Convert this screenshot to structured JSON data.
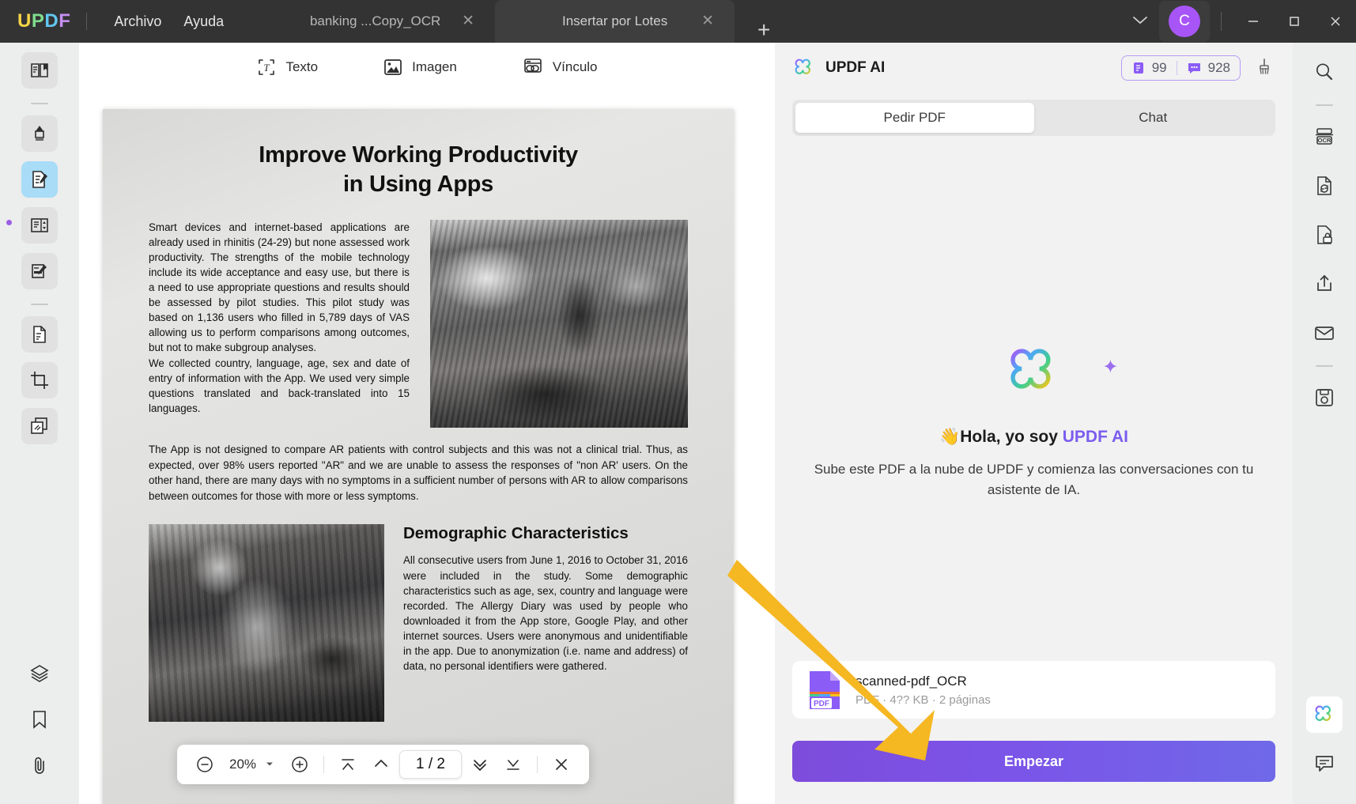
{
  "titlebar": {
    "logo": {
      "u": "U",
      "p": "P",
      "d": "D",
      "f": "F"
    },
    "menus": [
      {
        "name": "archivo",
        "label": "Archivo"
      },
      {
        "name": "ayuda",
        "label": "Ayuda"
      }
    ],
    "tabs": [
      {
        "name": "tab-banking",
        "label": "banking ...Copy_OCR",
        "active": false
      },
      {
        "name": "tab-insertar",
        "label": "Insertar por Lotes",
        "active": true
      }
    ],
    "new_tab_label": "+",
    "chevron_label": "⌄",
    "avatar_initial": "C",
    "window_controls": {
      "minimize": "—",
      "maximize": "☐",
      "close": "✕"
    }
  },
  "doc_toolbar": {
    "items": [
      {
        "name": "texto",
        "label": "Texto",
        "icon": "text-box-icon"
      },
      {
        "name": "imagen",
        "label": "Imagen",
        "icon": "image-icon"
      },
      {
        "name": "vinculo",
        "label": "Vínculo",
        "icon": "link-icon"
      }
    ]
  },
  "left_rail": {
    "items": [
      {
        "name": "reader",
        "icon": "book-reader-icon",
        "selected": false
      },
      {
        "name": "highlighter",
        "icon": "marker-pen-icon",
        "selected": false
      },
      {
        "name": "edit-pdf",
        "icon": "edit-document-icon",
        "selected": true
      },
      {
        "name": "organize-pages",
        "icon": "page-organize-icon",
        "selected": false
      },
      {
        "name": "fill-and-sign",
        "icon": "form-fill-icon",
        "selected": false
      },
      {
        "name": "convert",
        "icon": "document-convert-icon",
        "selected": false
      },
      {
        "name": "crop",
        "icon": "crop-icon",
        "selected": false
      },
      {
        "name": "compare",
        "icon": "layers-copy-icon",
        "selected": false
      },
      {
        "name": "layers",
        "icon": "stack-layers-icon",
        "selected": false
      },
      {
        "name": "bookmarks",
        "icon": "bookmark-icon",
        "selected": false
      },
      {
        "name": "attachments",
        "icon": "paperclip-icon",
        "selected": false
      }
    ]
  },
  "right_rail": {
    "items": [
      {
        "name": "search",
        "icon": "search-icon"
      },
      {
        "name": "ocr",
        "icon": "ocr-icon"
      },
      {
        "name": "convert",
        "icon": "file-refresh-icon"
      },
      {
        "name": "protect",
        "icon": "file-lock-icon"
      },
      {
        "name": "share",
        "icon": "share-upload-icon"
      },
      {
        "name": "email",
        "icon": "envelope-icon"
      },
      {
        "name": "save",
        "icon": "floppy-save-icon"
      },
      {
        "name": "updf-ai",
        "icon": "updf-ai-flower-icon"
      },
      {
        "name": "comments",
        "icon": "comment-bubble-icon"
      }
    ]
  },
  "zoombar": {
    "zoom_out": "−",
    "zoom_level": "20%",
    "zoom_in": "+",
    "dropdown": "▼",
    "page_indicator": "1 / 2",
    "first_page": "first-page-icon",
    "prev_page": "prev-page-icon",
    "next_page": "next-page-icon",
    "last_page": "last-page-icon",
    "close": "✕"
  },
  "document": {
    "title": "Improve Working Productivity\nin Using Apps",
    "title_line1": "Improve Working Productivity",
    "title_line2": "in Using Apps",
    "paragraph1": "Smart devices and internet-based applications are already used in rhinitis (24-29) but none assessed work productivity. The strengths of the mobile technology include its wide acceptance and easy use, but there is a need to use appropriate questions and results should be assessed by pilot studies. This pilot study was based on 1,136 users who filled in 5,789 days of VAS allowing us to perform comparisons among outcomes, but not to make subgroup analyses.",
    "paragraph1b": "We collected country, language, age, sex and date of entry of information with the App. We used very simple questions translated and back-translated into 15 languages.",
    "paragraph2": "The App is not designed to compare AR patients with control subjects and this was not a clinical trial. Thus, as expected, over 98% users reported \"AR\" and we are unable to assess the responses of \"non AR' users. On the other hand, there are many days with no symptoms in a sufficient number of persons with AR to allow comparisons between outcomes for those with more or less symptoms.",
    "section_heading": "Demographic Characteristics",
    "paragraph3": "All consecutive users from June 1, 2016 to October 31, 2016 were included in the study. Some demographic characteristics such as age, sex, country and language were recorded. The Allergy Diary was used by people who downloaded it from the App store, Google Play, and other internet sources. Users were anonymous and unidentifiable in the app. Due to anonymization (i.e. name and address) of data, no personal identifiers were gathered."
  },
  "ai_panel": {
    "title": "UPDF AI",
    "credits": {
      "doc_count": "99",
      "chat_count": "928"
    },
    "broom_icon": "broom-clear-icon",
    "tabs": [
      {
        "name": "pedir-pdf",
        "label": "Pedir PDF",
        "active": true
      },
      {
        "name": "chat",
        "label": "Chat",
        "active": false
      }
    ],
    "greeting_emoji": "👋",
    "greeting_text": "Hola, yo soy ",
    "greeting_brand": "UPDF AI",
    "subtitle": "Sube este PDF a la nube de UPDF y comienza las conversaciones con tu asistente de IA.",
    "file": {
      "name": "scanned-pdf_OCR",
      "meta": "PDF · 4?? KB · 2 páginas",
      "badge": "PDF"
    },
    "start_button": "Empezar"
  },
  "colors": {
    "accent_purple": "#7c5cf0",
    "arrow_yellow": "#f5b722",
    "selected_blue": "#a8dcf7",
    "titlebar_bg": "#333333",
    "panel_bg": "#f2f2f2"
  }
}
